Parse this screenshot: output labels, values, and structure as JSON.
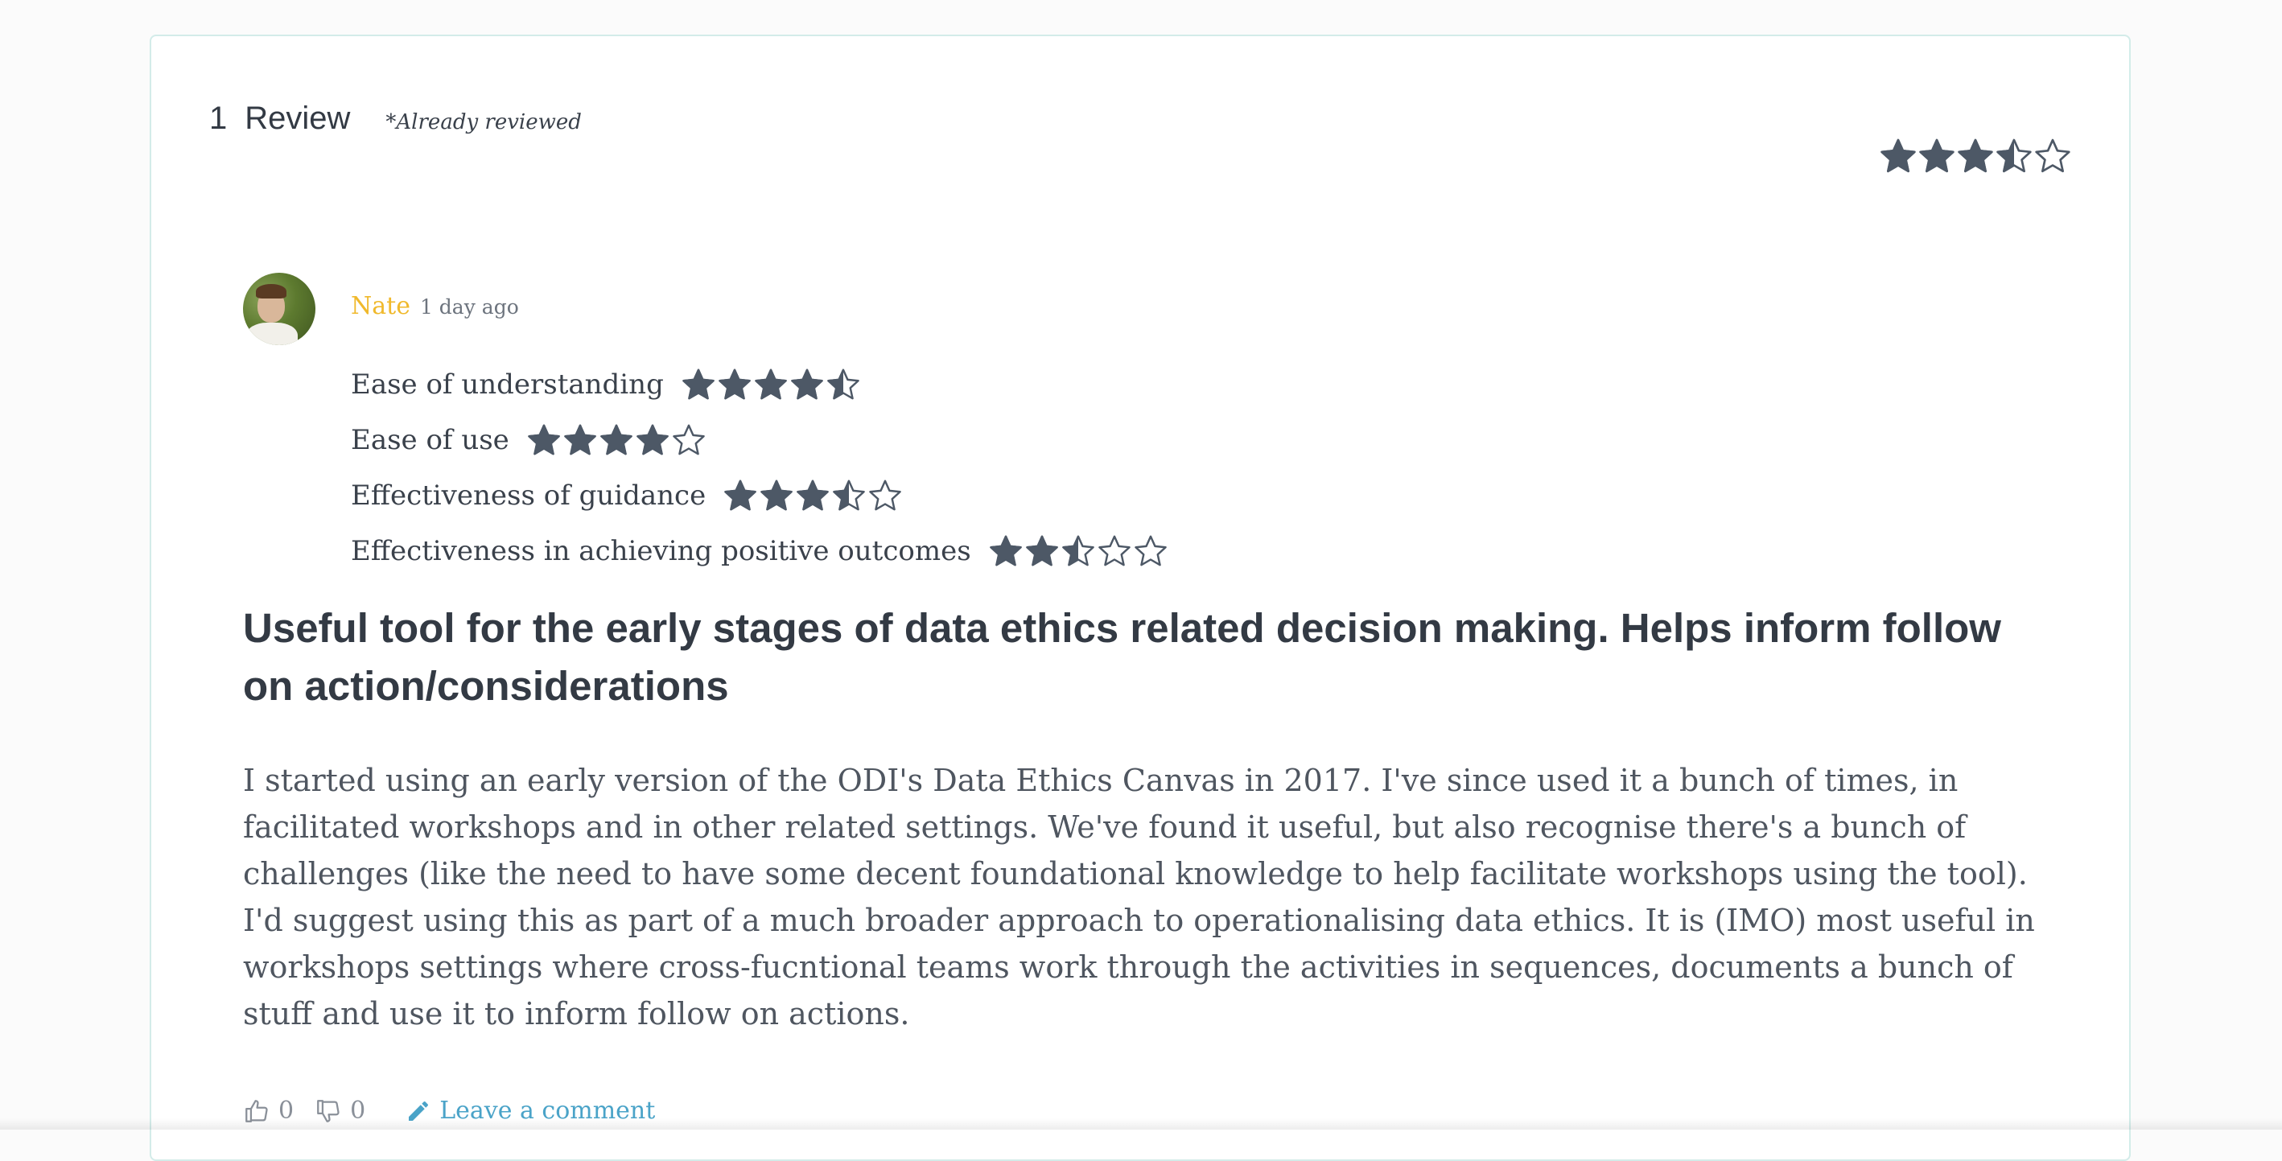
{
  "review_header": {
    "count": "1",
    "label": "Review",
    "already_reviewed_note": "*Already reviewed",
    "overall_rating": 3.5,
    "max_rating": 5
  },
  "review": {
    "author": "Nate",
    "time_ago": "1 day ago",
    "avatar_icon": "user-avatar-photo",
    "ratings": [
      {
        "label": "Ease of understanding",
        "value": 4.5
      },
      {
        "label": "Ease of use",
        "value": 4
      },
      {
        "label": "Effectiveness of guidance",
        "value": 3.5
      },
      {
        "label": "Effectiveness in achieving positive outcomes",
        "value": 2.5
      }
    ],
    "title": "Useful tool for the early stages of data ethics related decision making. Helps inform follow on action/considerations",
    "body": "I started using an early version of the ODI's Data Ethics Canvas in 2017. I've since used it a bunch of times, in facilitated workshops and in other related settings. We've found it useful, but also recognise there's a bunch of challenges (like the need to have some decent foundational knowledge to help facilitate workshops using the tool). I'd suggest using this as part of a much broader approach to operationalising data ethics. It is (IMO) most useful in workshops settings where cross-fucntional teams work through the activities in sequences, documents a bunch of stuff and use it to inform follow on actions.",
    "actions": {
      "thumbs_up_count": "0",
      "thumbs_down_count": "0",
      "comment_label": "Leave a comment",
      "thumbs_up_icon": "thumbs-up-icon",
      "thumbs_down_icon": "thumbs-down-icon",
      "comment_icon": "pencil-icon"
    }
  },
  "colors": {
    "star_fill": "#4d5866",
    "author": "#f0b92c",
    "link": "#4aa3c8",
    "card_border": "#d3ece9"
  }
}
